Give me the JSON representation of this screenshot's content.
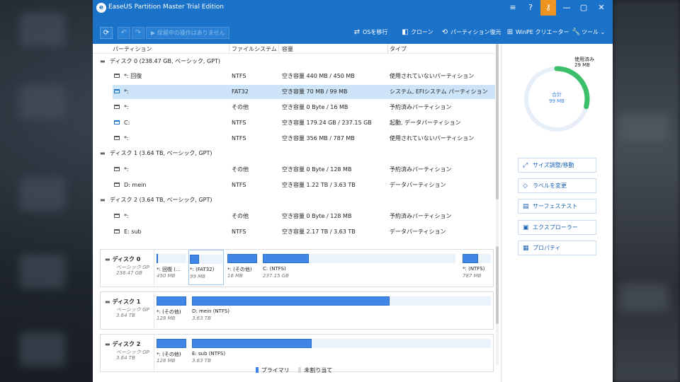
{
  "window": {
    "title": "EaseUS Partition Master Trial Edition",
    "controls": {
      "menu": "≡",
      "help": "?",
      "key": "⚷",
      "minimize": "—",
      "maximize": "▢",
      "close": "✕"
    }
  },
  "toolbar": {
    "refresh": "⟳",
    "undo": "↶",
    "redo": "↷",
    "pending_ops": "▶ 保留中の操作はありません",
    "tools": [
      {
        "icon": "⇄",
        "label": "OSを移行"
      },
      {
        "icon": "◧",
        "label": "クローン"
      },
      {
        "icon": "⟲",
        "label": "パーティション復元"
      },
      {
        "icon": "⊞",
        "label": "WinPE クリエーター"
      },
      {
        "icon": "🔧",
        "label": "ツール ⌄"
      }
    ]
  },
  "table": {
    "headers": [
      "パーティション",
      "ファイルシステム",
      "容量",
      "タイプ"
    ],
    "disks": [
      {
        "label": "ディスク 0 (238.47 GB, ベーシック, GPT)",
        "rows": [
          {
            "name": "*: 回復",
            "fs": "NTFS",
            "cap": "空き容量 440 MB / 450 MB",
            "type": "使用されていないパーティション"
          },
          {
            "name": "*:",
            "fs": "FAT32",
            "cap": "空き容量 70 MB / 99 MB",
            "type": "システム, EFIシステム パーティション"
          },
          {
            "name": "*:",
            "fs": "その他",
            "cap": "空き容量 0 Byte / 16 MB",
            "type": "予約済みパーティション"
          },
          {
            "name": "C:",
            "fs": "NTFS",
            "cap": "空き容量 179.24 GB / 237.15 GB",
            "type": "起動, データパーティション"
          },
          {
            "name": "*:",
            "fs": "NTFS",
            "cap": "空き容量 356 MB / 787 MB",
            "type": "使用されていないパーティション"
          }
        ]
      },
      {
        "label": "ディスク 1 (3.64 TB, ベーシック, GPT)",
        "rows": [
          {
            "name": "*:",
            "fs": "その他",
            "cap": "空き容量 0 Byte / 128 MB",
            "type": "予約済みパーティション"
          },
          {
            "name": "D: mein",
            "fs": "NTFS",
            "cap": "空き容量 1.22 TB / 3.63 TB",
            "type": "データパーティション"
          }
        ]
      },
      {
        "label": "ディスク 2 (3.64 TB, ベーシック, GPT)",
        "rows": [
          {
            "name": "*:",
            "fs": "その他",
            "cap": "空き容量 0 Byte / 128 MB",
            "type": "予約済みパーティション"
          },
          {
            "name": "E: sub",
            "fs": "NTFS",
            "cap": "空き容量 2.17 TB / 3.63 TB",
            "type": "データパーティション"
          }
        ]
      }
    ]
  },
  "maps": [
    {
      "name": "ディスク 0",
      "kind": "ベーシック GP",
      "size": "238.47 GB",
      "segments": [
        {
          "label": "*: 回復 (…",
          "size": "450 MB",
          "fill": 0.02
        },
        {
          "label": "*: (FAT32)",
          "size": "99 MB",
          "fill": 0.29
        },
        {
          "label": "*: (その他)",
          "size": "16 MB",
          "fill": 1.0
        },
        {
          "label": "C: (NTFS)",
          "size": "237.15 GB",
          "fill": 0.24
        },
        {
          "label": "*: (NTFS)",
          "size": "787 MB",
          "fill": 0.55
        }
      ]
    },
    {
      "name": "ディスク 1",
      "kind": "ベーシック GP",
      "size": "3.64 TB",
      "segments": [
        {
          "label": "*: (その他)",
          "size": "128 MB",
          "fill": 1.0
        },
        {
          "label": "D: mein (NTFS)",
          "size": "3.63 TB",
          "fill": 0.66
        }
      ]
    },
    {
      "name": "ディスク 2",
      "kind": "ベーシック GP",
      "size": "3.64 TB",
      "segments": [
        {
          "label": "*: (その他)",
          "size": "128 MB",
          "fill": 1.0
        },
        {
          "label": "E: sub (NTFS)",
          "size": "3.63 TB",
          "fill": 0.4
        }
      ]
    }
  ],
  "legend": {
    "primary": "プライマリ",
    "unallocated": "未割り当て"
  },
  "colors": {
    "accent": "#1b72c9",
    "primary": "#3f86e6",
    "used_arc": "#3cbf6a",
    "ring": "#e6eef8",
    "key_btn": "#f0941f"
  },
  "panel": {
    "used_label": "使用済み",
    "used_value": "29 MB",
    "used_fraction": 0.29,
    "total_label": "合計",
    "total_value": "99 MB",
    "actions": [
      {
        "icon": "⤢",
        "label": "サイズ調整/移動"
      },
      {
        "icon": "◇",
        "label": "ラベルを変更"
      },
      {
        "icon": "▤",
        "label": "サーフェステスト"
      },
      {
        "icon": "▣",
        "label": "エクスプローラー"
      },
      {
        "icon": "▦",
        "label": "プロパティ"
      }
    ]
  }
}
